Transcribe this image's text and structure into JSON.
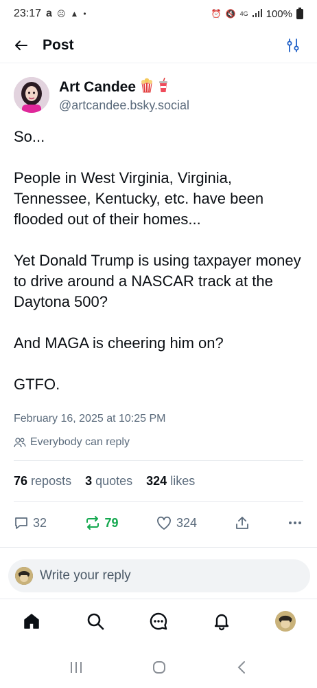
{
  "status_bar": {
    "time": "23:17",
    "left_icons": [
      "a-app-icon",
      "messenger-icon",
      "android-icon",
      "dot-icon"
    ],
    "right_icons": [
      "alarm-icon",
      "mute-icon",
      "4g-signal-icon",
      "signal-bars-icon"
    ],
    "battery": "100%"
  },
  "header": {
    "title": "Post"
  },
  "post": {
    "author_name": "Art Candee",
    "author_emoji": [
      "popcorn-icon",
      "drink-cup-icon"
    ],
    "author_handle": "@artcandee.bsky.social",
    "paragraphs": [
      "So...",
      "People in West Virginia, Virginia, Tennessee, Kentucky, etc. have been flooded out of their homes...",
      "Yet Donald Trump is using taxpayer money to drive around a NASCAR track at the Daytona 500?",
      "And MAGA is cheering him on?",
      "GTFO."
    ],
    "timestamp": "February 16, 2025 at 10:25 PM",
    "reply_setting": "Everybody can reply"
  },
  "stats": {
    "reposts_count": "76",
    "reposts_label": "reposts",
    "quotes_count": "3",
    "quotes_label": "quotes",
    "likes_count": "324",
    "likes_label": "likes"
  },
  "actions": {
    "replies": "32",
    "reposts": "79",
    "likes": "324"
  },
  "reply_box": {
    "placeholder": "Write your reply"
  },
  "colors": {
    "repost_active": "#14a84f",
    "muted_text": "#5b6b7c"
  }
}
